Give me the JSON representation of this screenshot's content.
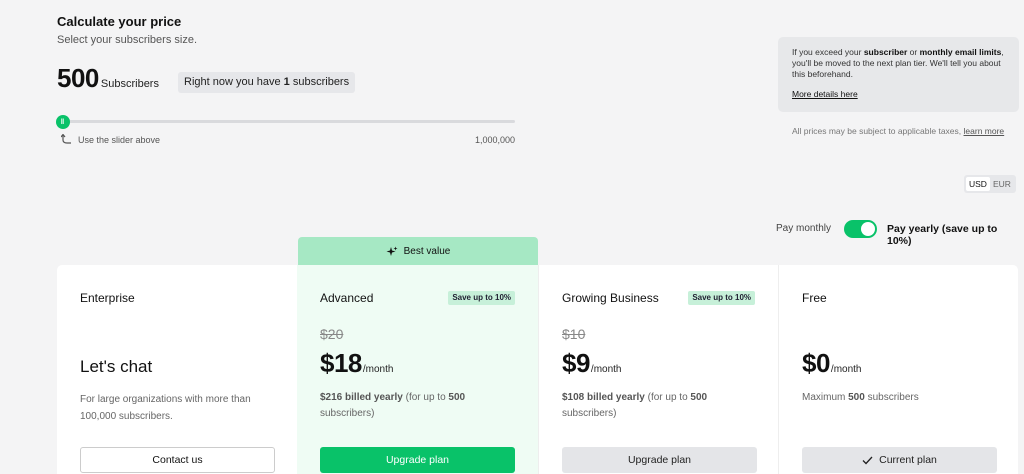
{
  "calculator": {
    "title": "Calculate your price",
    "subtitle": "Select your subscribers size.",
    "count": "500",
    "count_unit": "Subscribers",
    "current_prefix": "Right now you have ",
    "current_count": "1",
    "current_suffix": " subscribers",
    "slider_hint": "Use the slider above",
    "slider_max": "1,000,000",
    "slider_level": 0.0
  },
  "info": {
    "t1": "If you exceed your ",
    "b1": "subscriber",
    "t2": " or ",
    "b2": "monthly email limits",
    "t3": ", you'll be moved to the next plan tier. We'll tell you about this beforehand.",
    "link": "More details here",
    "tax_text": "All prices may be subject to applicable taxes, ",
    "tax_link": "learn more"
  },
  "currency": {
    "usd": "USD",
    "eur": "EUR",
    "selected": "USD"
  },
  "billing": {
    "monthly_label": "Pay monthly",
    "yearly_label": "Pay yearly (save up to 10%)",
    "yearly_on": true
  },
  "best_value_label": "Best value",
  "plans": {
    "enterprise": {
      "name": "Enterprise",
      "headline": "Let's chat",
      "description": "For large organizations with more than 100,000 subscribers.",
      "button": "Contact us"
    },
    "advanced": {
      "name": "Advanced",
      "badge": "Save up to 10%",
      "old_price": "$20",
      "price": "$18",
      "per": "/month",
      "billed": "$216 billed yearly",
      "billed_mid": " (for up to ",
      "billed_count": "500",
      "billed_end": " subscribers)",
      "button": "Upgrade plan"
    },
    "growing": {
      "name": "Growing Business",
      "badge": "Save up to 10%",
      "old_price": "$10",
      "price": "$9",
      "per": "/month",
      "billed": "$108 billed yearly",
      "billed_mid": " (for up to ",
      "billed_count": "500",
      "billed_end": " subscribers)",
      "button": "Upgrade plan"
    },
    "free": {
      "name": "Free",
      "price": "$0",
      "per": "/month",
      "desc_prefix": "Maximum ",
      "desc_count": "500",
      "desc_suffix": " subscribers",
      "button": "Current plan"
    }
  },
  "colors": {
    "accent": "#09c269",
    "best_value_bg": "#a6e8c4",
    "highlight_bg": "#effcf4"
  }
}
